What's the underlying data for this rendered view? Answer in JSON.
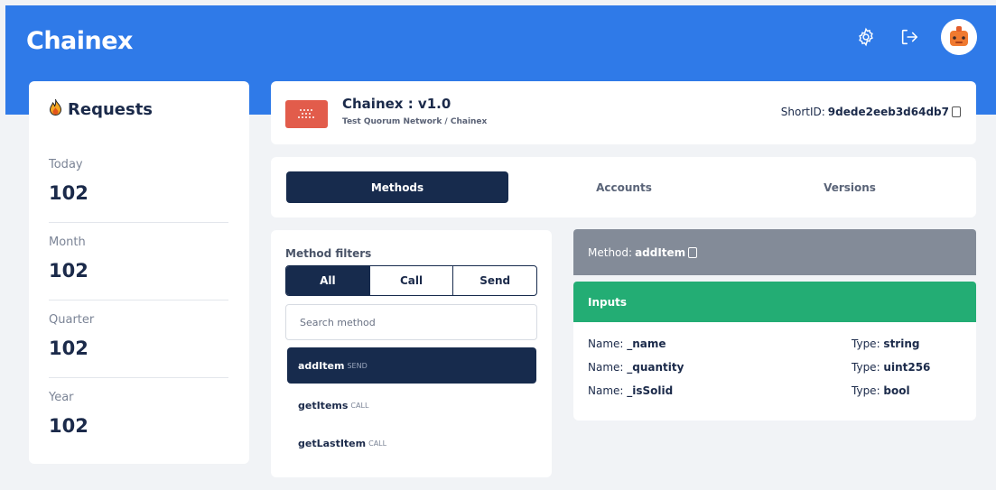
{
  "app": {
    "brand": "Chainex"
  },
  "topbar": {
    "icons": [
      "gear-icon",
      "logout-icon",
      "avatar"
    ]
  },
  "requests": {
    "title": "Requests",
    "icon": "fire-icon",
    "stats": [
      {
        "label": "Today",
        "value": "102"
      },
      {
        "label": "Month",
        "value": "102"
      },
      {
        "label": "Quarter",
        "value": "102"
      },
      {
        "label": "Year",
        "value": "102"
      }
    ]
  },
  "project": {
    "name": "Chainex : v1.0",
    "breadcrumb": "Test Quorum Network / Chainex",
    "shortid_label": "ShortID: ",
    "shortid_value": "9dede2eeb3d64db7"
  },
  "tabs": [
    {
      "label": "Methods",
      "active": true
    },
    {
      "label": "Accounts",
      "active": false
    },
    {
      "label": "Versions",
      "active": false
    }
  ],
  "filters": {
    "label": "Method filters",
    "options": [
      {
        "label": "All",
        "active": true
      },
      {
        "label": "Call",
        "active": false
      },
      {
        "label": "Send",
        "active": false
      }
    ],
    "search_placeholder": "Search method"
  },
  "methods": [
    {
      "name": "addItem",
      "kind": "SEND",
      "active": true
    },
    {
      "name": "getItems",
      "kind": "CALL",
      "active": false
    },
    {
      "name": "getLastItem",
      "kind": "CALL",
      "active": false
    }
  ],
  "detail": {
    "method_label": "Method: ",
    "method_name": "addItem",
    "inputs_title": "Inputs",
    "name_label": "Name: ",
    "type_label": "Type: ",
    "inputs": [
      {
        "name": "_name",
        "type": "string"
      },
      {
        "name": "_quantity",
        "type": "uint256"
      },
      {
        "name": "_isSolid",
        "type": "bool"
      }
    ]
  },
  "colors": {
    "header": "#2f7ae8",
    "navy": "#172b4d",
    "inputs_green": "#23ad74",
    "method_grey": "#838b98",
    "project_logo": "#e25c4b"
  }
}
